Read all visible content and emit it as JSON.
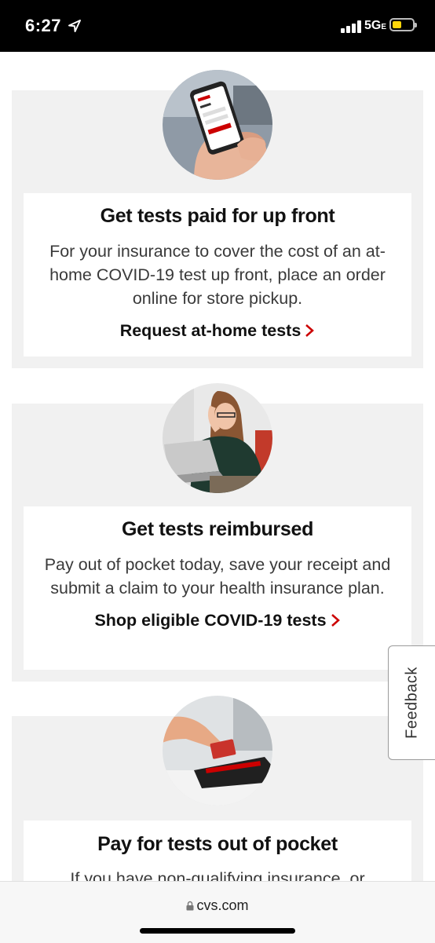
{
  "status_bar": {
    "time": "6:27",
    "network": "5G",
    "network_suffix": "E"
  },
  "cards": [
    {
      "title": "Get tests paid for up front",
      "description": "For your insurance to cover the cost of an at-home COVID-19 test up front, place an order online for store pickup.",
      "cta": "Request at-home tests"
    },
    {
      "title": "Get tests reimbursed",
      "description": "Pay out of pocket today, save your receipt and submit a claim to your health insurance plan.",
      "cta": "Shop eligible COVID-19 tests"
    },
    {
      "title": "Pay for tests out of pocket",
      "description": "If you have non-qualifying insurance, or"
    }
  ],
  "feedback_label": "Feedback",
  "url_bar": {
    "domain": "cvs.com"
  },
  "colors": {
    "accent": "#cc0000",
    "card_bg": "#f1f1f1"
  }
}
